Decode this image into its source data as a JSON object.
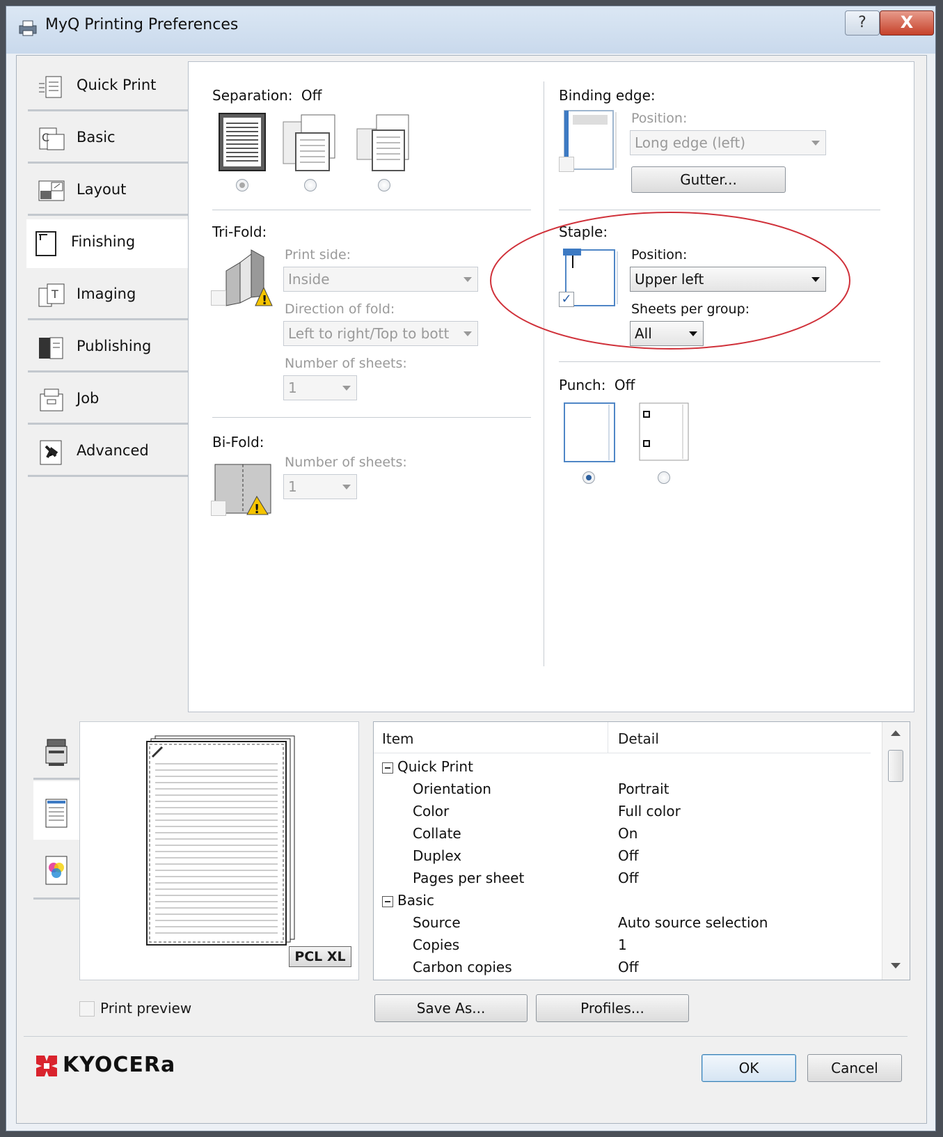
{
  "window": {
    "title": "MyQ Printing Preferences",
    "help_glyph": "?",
    "close_glyph": "X"
  },
  "tabs": [
    {
      "label": "Quick Print",
      "icon": "quick-print-icon"
    },
    {
      "label": "Basic",
      "icon": "basic-icon"
    },
    {
      "label": "Layout",
      "icon": "layout-icon"
    },
    {
      "label": "Finishing",
      "icon": "finishing-icon",
      "active": true
    },
    {
      "label": "Imaging",
      "icon": "imaging-icon"
    },
    {
      "label": "Publishing",
      "icon": "publishing-icon"
    },
    {
      "label": "Job",
      "icon": "job-icon"
    },
    {
      "label": "Advanced",
      "icon": "advanced-icon"
    }
  ],
  "separation": {
    "label": "Separation:",
    "value": "Off"
  },
  "trifold": {
    "label": "Tri-Fold:",
    "print_side_label": "Print side:",
    "print_side_value": "Inside",
    "direction_label": "Direction of fold:",
    "direction_value": "Left to right/Top to bott",
    "sheets_label": "Number of sheets:",
    "sheets_value": "1"
  },
  "bifold": {
    "label": "Bi-Fold:",
    "sheets_label": "Number of sheets:",
    "sheets_value": "1"
  },
  "binding": {
    "label": "Binding edge:",
    "position_label": "Position:",
    "position_value": "Long edge (left)",
    "gutter_button": "Gutter..."
  },
  "staple": {
    "label": "Staple:",
    "position_label": "Position:",
    "position_value": "Upper left",
    "sheets_label": "Sheets per group:",
    "sheets_value": "All",
    "checked": true,
    "highlight_color": "#d0313a"
  },
  "punch": {
    "label": "Punch:",
    "value": "Off"
  },
  "preview": {
    "badge": "PCL XL",
    "print_preview_label": "Print preview"
  },
  "summary": {
    "col_item": "Item",
    "col_detail": "Detail",
    "rows": [
      {
        "group": true,
        "item": "Quick Print",
        "detail": ""
      },
      {
        "item": "Orientation",
        "detail": "Portrait"
      },
      {
        "item": "Color",
        "detail": "Full color"
      },
      {
        "item": "Collate",
        "detail": "On"
      },
      {
        "item": "Duplex",
        "detail": "Off"
      },
      {
        "item": "Pages per sheet",
        "detail": "Off"
      },
      {
        "group": true,
        "item": "Basic",
        "detail": ""
      },
      {
        "item": "Source",
        "detail": "Auto source selection"
      },
      {
        "item": "Copies",
        "detail": "1"
      },
      {
        "item": "Carbon copies",
        "detail": "Off"
      }
    ]
  },
  "buttons": {
    "save_as": "Save As...",
    "profiles": "Profiles...",
    "ok": "OK",
    "cancel": "Cancel"
  },
  "brand": {
    "name": "KYOCERa",
    "color": "#d9232d"
  }
}
